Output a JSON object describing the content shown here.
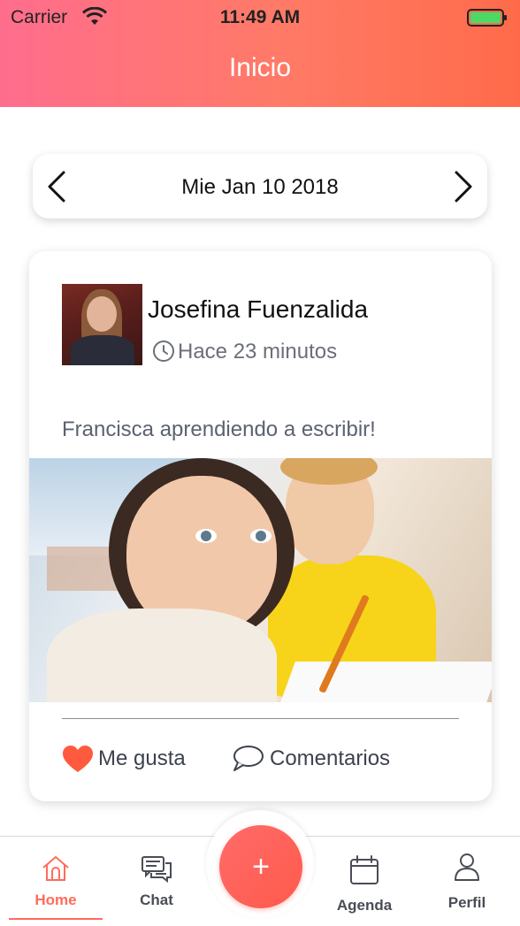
{
  "status_bar": {
    "carrier": "Carrier",
    "time": "11:49 AM"
  },
  "header": {
    "title": "Inicio"
  },
  "date_selector": {
    "date": "Mie Jan 10 2018"
  },
  "post": {
    "author": "Josefina Fuenzalida",
    "timestamp": "Hace 23 minutos",
    "caption": "Francisca aprendiendo a escribir!",
    "like_label": "Me gusta",
    "comments_label": "Comentarios"
  },
  "tab_bar": {
    "home": "Home",
    "chat": "Chat",
    "add": "+",
    "agenda": "Agenda",
    "perfil": "Perfil",
    "active_tab": "Home"
  },
  "colors": {
    "accent": "#ff6b5b",
    "header_gradient_start": "#ff6d8d",
    "header_gradient_end": "#ff6b4a",
    "battery_fill": "#4cd964"
  },
  "icons": {
    "wifi": "wifi-icon",
    "battery": "battery-icon",
    "prev": "chevron-left-icon",
    "next": "chevron-right-icon",
    "clock": "clock-icon",
    "heart": "heart-icon",
    "comment": "comment-bubble-icon",
    "home": "home-icon",
    "chat": "chat-icon",
    "agenda": "calendar-icon",
    "perfil": "user-icon"
  }
}
